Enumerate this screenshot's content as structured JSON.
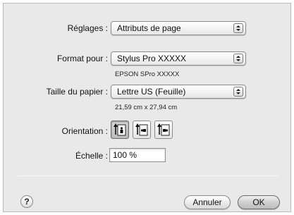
{
  "settings": {
    "label": "Réglages :",
    "value": "Attributs de page"
  },
  "format_for": {
    "label": "Format pour :",
    "value": "Stylus Pro XXXXX",
    "detail": "EPSON SPro XXXXX"
  },
  "paper_size": {
    "label": "Taille du papier :",
    "value": "Lettre US (Feuille)",
    "detail": "21,59 cm x 27,94 cm"
  },
  "orientation": {
    "label": "Orientation :",
    "options": [
      "portrait",
      "landscape",
      "landscape-reversed"
    ],
    "selected": "portrait"
  },
  "scale": {
    "label": "Échelle :",
    "value": "100 %"
  },
  "footer": {
    "help_label": "?",
    "cancel_label": "Annuler",
    "ok_label": "OK"
  }
}
